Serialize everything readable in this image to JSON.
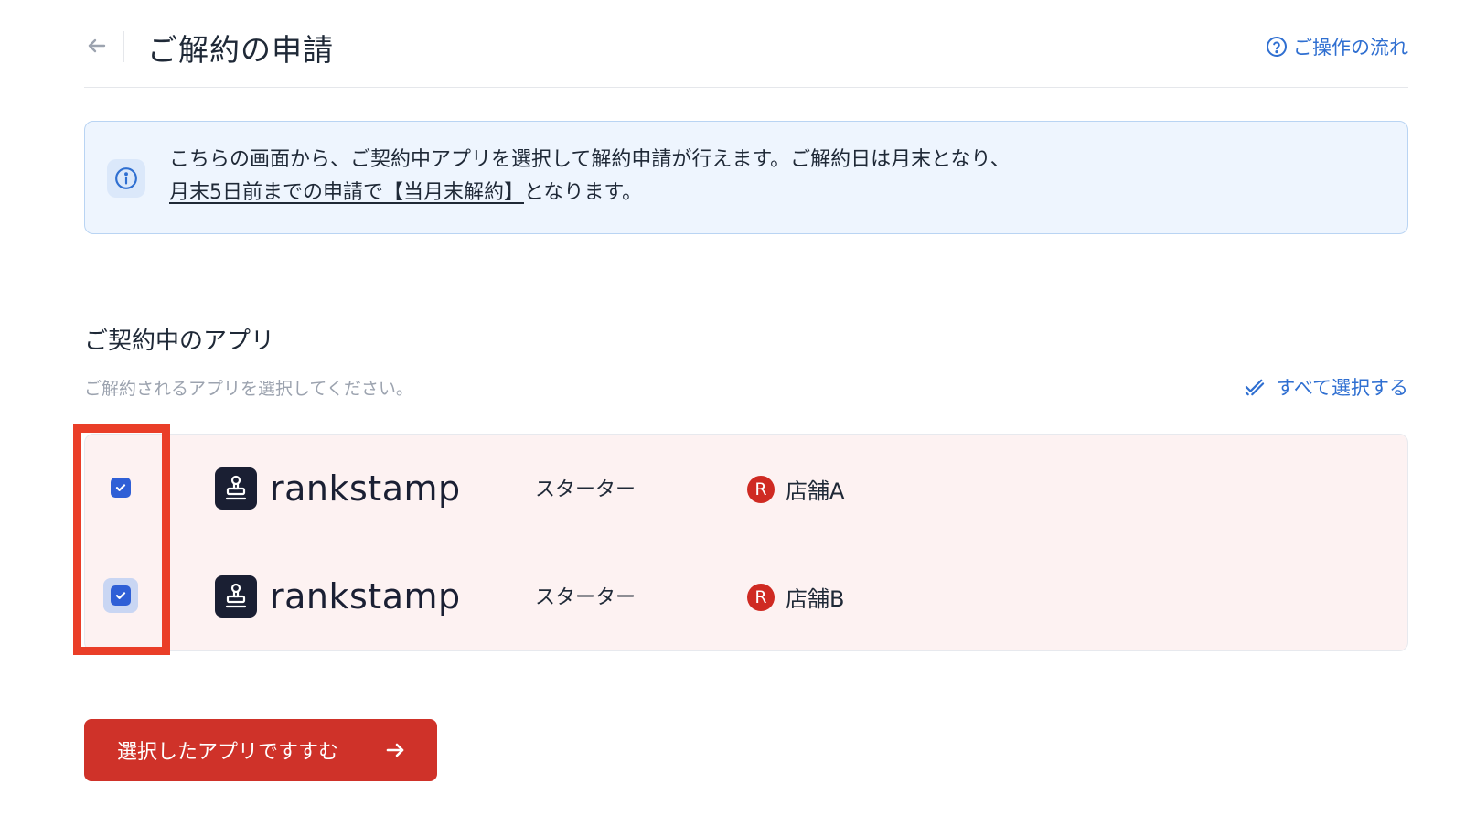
{
  "header": {
    "title": "ご解約の申請",
    "help_link": "ご操作の流れ"
  },
  "info": {
    "text_before": "こちらの画面から、ご契約中アプリを選択して解約申請が行えます。ご解約日は月末となり、",
    "text_underlined": "月末5日前までの申請で【当月末解約】",
    "text_after": "となります。"
  },
  "section": {
    "title": "ご契約中のアプリ",
    "subtitle": "ご解約されるアプリを選択してください。",
    "select_all": "すべて選択する"
  },
  "apps": [
    {
      "name": "rankstamp",
      "plan": "スターター",
      "shop_badge": "R",
      "shop": "店舗A",
      "checked": true
    },
    {
      "name": "rankstamp",
      "plan": "スターター",
      "shop_badge": "R",
      "shop": "店舗B",
      "checked": true
    }
  ],
  "actions": {
    "next_button": "選択したアプリですすむ"
  },
  "colors": {
    "accent_blue": "#2f6fd1",
    "brand_red": "#cf3229",
    "checkbox_blue": "#2f5fd6",
    "highlight_red": "#ea3e28"
  }
}
